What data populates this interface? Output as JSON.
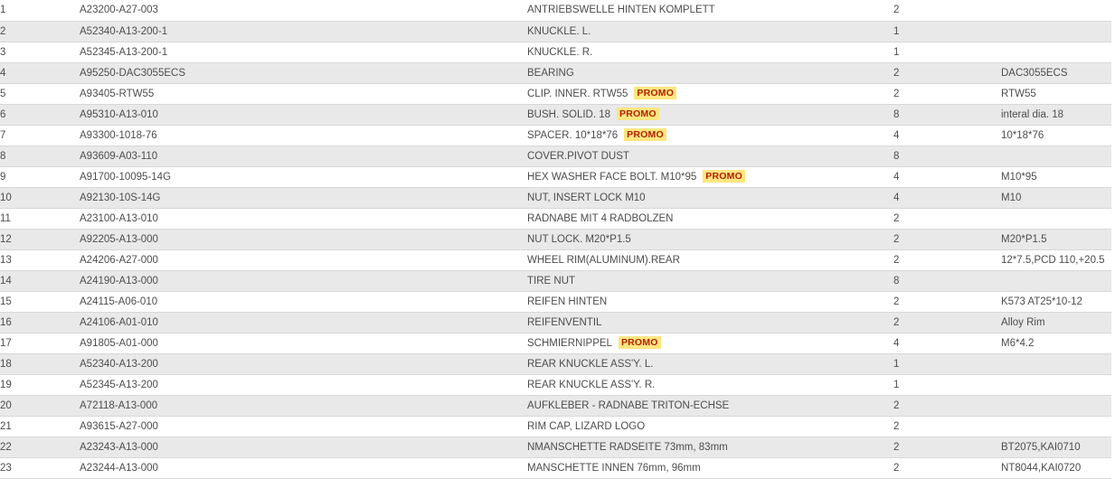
{
  "table": {
    "promo_label": "PROMO",
    "columns": [
      "index",
      "part_number",
      "description",
      "quantity",
      "note"
    ],
    "rows": [
      {
        "index": "1",
        "part_number": "A23200-A27-003",
        "description": "ANTRIEBSWELLE HINTEN KOMPLETT",
        "promo": false,
        "quantity": "2",
        "note": ""
      },
      {
        "index": "2",
        "part_number": "A52340-A13-200-1",
        "description": "KNUCKLE. L.",
        "promo": false,
        "quantity": "1",
        "note": ""
      },
      {
        "index": "3",
        "part_number": "A52345-A13-200-1",
        "description": "KNUCKLE. R.",
        "promo": false,
        "quantity": "1",
        "note": ""
      },
      {
        "index": "4",
        "part_number": "A95250-DAC3055ECS",
        "description": "BEARING",
        "promo": false,
        "quantity": "2",
        "note": "DAC3055ECS"
      },
      {
        "index": "5",
        "part_number": "A93405-RTW55",
        "description": "CLIP. INNER. RTW55",
        "promo": true,
        "quantity": "2",
        "note": "RTW55"
      },
      {
        "index": "6",
        "part_number": "A95310-A13-010",
        "description": "BUSH. SOLID. 18",
        "promo": true,
        "quantity": "8",
        "note": "interal dia. 18"
      },
      {
        "index": "7",
        "part_number": "A93300-1018-76",
        "description": "SPACER. 10*18*76",
        "promo": true,
        "quantity": "4",
        "note": "10*18*76"
      },
      {
        "index": "8",
        "part_number": "A93609-A03-110",
        "description": "COVER.PIVOT DUST",
        "promo": false,
        "quantity": "8",
        "note": ""
      },
      {
        "index": "9",
        "part_number": "A91700-10095-14G",
        "description": "HEX WASHER FACE BOLT. M10*95",
        "promo": true,
        "quantity": "4",
        "note": "M10*95"
      },
      {
        "index": "10",
        "part_number": "A92130-10S-14G",
        "description": "NUT, INSERT LOCK M10",
        "promo": false,
        "quantity": "4",
        "note": "M10"
      },
      {
        "index": "11",
        "part_number": "A23100-A13-010",
        "description": "RADNABE MIT 4 RADBOLZEN",
        "promo": false,
        "quantity": "2",
        "note": ""
      },
      {
        "index": "12",
        "part_number": "A92205-A13-000",
        "description": "NUT LOCK. M20*P1.5",
        "promo": false,
        "quantity": "2",
        "note": "M20*P1.5"
      },
      {
        "index": "13",
        "part_number": "A24206-A27-000",
        "description": "WHEEL RIM(ALUMINUM).REAR",
        "promo": false,
        "quantity": "2",
        "note": "12*7.5,PCD 110,+20.5"
      },
      {
        "index": "14",
        "part_number": "A24190-A13-000",
        "description": "TIRE NUT",
        "promo": false,
        "quantity": "8",
        "note": ""
      },
      {
        "index": "15",
        "part_number": "A24115-A06-010",
        "description": "REIFEN HINTEN",
        "promo": false,
        "quantity": "2",
        "note": "K573 AT25*10-12"
      },
      {
        "index": "16",
        "part_number": "A24106-A01-010",
        "description": "REIFENVENTIL",
        "promo": false,
        "quantity": "2",
        "note": "Alloy Rim"
      },
      {
        "index": "17",
        "part_number": "A91805-A01-000",
        "description": "SCHMIERNIPPEL",
        "promo": true,
        "quantity": "4",
        "note": "M6*4.2"
      },
      {
        "index": "18",
        "part_number": "A52340-A13-200",
        "description": "REAR KNUCKLE ASS'Y. L.",
        "promo": false,
        "quantity": "1",
        "note": ""
      },
      {
        "index": "19",
        "part_number": "A52345-A13-200",
        "description": "REAR KNUCKLE ASS'Y. R.",
        "promo": false,
        "quantity": "1",
        "note": ""
      },
      {
        "index": "20",
        "part_number": "A72118-A13-000",
        "description": "AUFKLEBER - RADNABE TRITON-ECHSE",
        "promo": false,
        "quantity": "2",
        "note": ""
      },
      {
        "index": "21",
        "part_number": "A93615-A27-000",
        "description": "RIM CAP, LIZARD LOGO",
        "promo": false,
        "quantity": "2",
        "note": ""
      },
      {
        "index": "22",
        "part_number": "A23243-A13-000",
        "description": "NMANSCHETTE RADSEITE 73mm, 83mm",
        "promo": false,
        "quantity": "2",
        "note": "BT2075,KAI0710"
      },
      {
        "index": "23",
        "part_number": "A23244-A13-000",
        "description": "MANSCHETTE INNEN 76mm, 96mm",
        "promo": false,
        "quantity": "2",
        "note": "NT8044,KAI0720"
      }
    ]
  },
  "colors": {
    "row_even_bg": "#e9e9e9",
    "row_odd_bg": "#ffffff",
    "row_border": "#d8d8d8",
    "text": "#4d4d4d",
    "promo_bg": "#ffe680",
    "promo_text": "#b22000"
  }
}
